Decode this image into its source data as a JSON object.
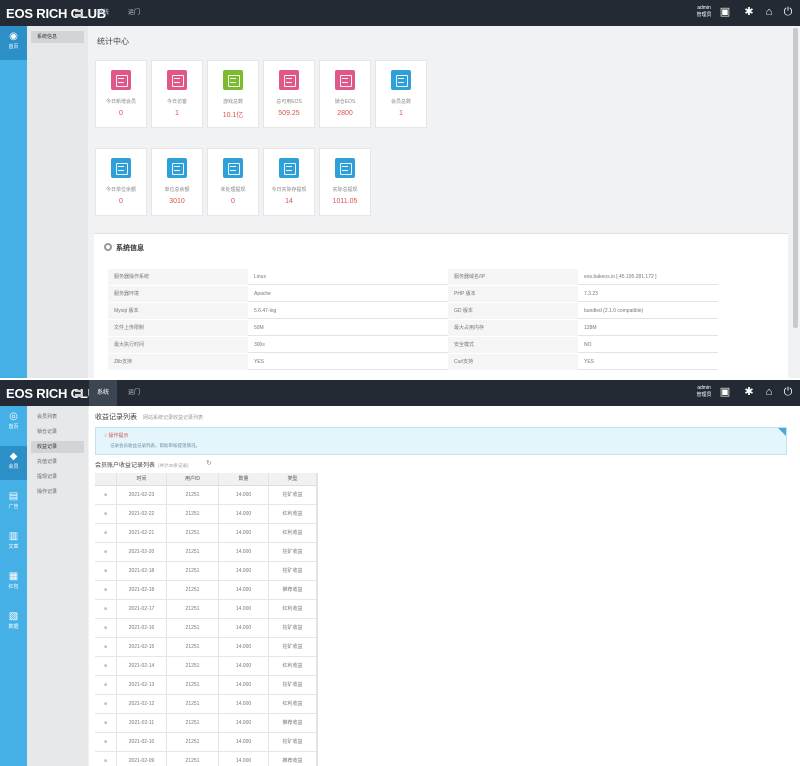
{
  "brand": "EOS RICH CLUB",
  "nav": [
    {
      "label": "系统",
      "active": true
    },
    {
      "label": "运门",
      "active": false
    }
  ],
  "user": {
    "name": "admin",
    "role": "管理员"
  },
  "shot1": {
    "rail": [
      {
        "label": "首页",
        "icon": "home-icon"
      }
    ],
    "submenu": [
      {
        "label": "系统信息",
        "active": true
      }
    ],
    "page_title": "统计中心",
    "cards_row1": [
      {
        "label": "今日新增会员",
        "value": "0",
        "color": "#e0578a"
      },
      {
        "label": "今日访客",
        "value": "1",
        "color": "#e0578a"
      },
      {
        "label": "游戏总数",
        "value": "10.1亿",
        "color": "#7cbb2f"
      },
      {
        "label": "总可用EOS",
        "value": "509.25",
        "color": "#e0578a"
      },
      {
        "label": "锁仓EOS",
        "value": "2800",
        "color": "#e0578a"
      },
      {
        "label": "会员总数",
        "value": "1",
        "color": "#2f9fd8"
      }
    ],
    "cards_row2": [
      {
        "label": "今日单位余额",
        "value": "0",
        "color": "#2f9fd8"
      },
      {
        "label": "单位总余额",
        "value": "3010",
        "color": "#2f9fd8"
      },
      {
        "label": "未处理提现",
        "value": "0",
        "color": "#2f9fd8"
      },
      {
        "label": "今日实际存提现",
        "value": "14",
        "color": "#2f9fd8"
      },
      {
        "label": "实际总提现",
        "value": "1011.05",
        "color": "#2f9fd8"
      }
    ],
    "sys_title": "系统信息",
    "sys_rows": [
      {
        "k1": "服务器操作系统",
        "v1": "Linux",
        "k2": "服务器域名/IP",
        "v2": "eos.bakeos.io [ 45.195.281.172 ]"
      },
      {
        "k1": "服务器环境",
        "v1": "Apache",
        "k2": "PHP 版本",
        "v2": "7.3.23"
      },
      {
        "k1": "Mysql 版本",
        "v1": "5.6.47-log",
        "k2": "GD 版本",
        "v2": "bundled (2.1.0 compatible)"
      },
      {
        "k1": "文件上传限制",
        "v1": "50M",
        "k2": "最大占用内存",
        "v2": "128M"
      },
      {
        "k1": "最大执行时间",
        "v1": "300s",
        "k2": "安全模式",
        "v2": "NO"
      },
      {
        "k1": "Zlib支持",
        "v1": "YES",
        "k2": "Curl支持",
        "v2": "YES"
      }
    ]
  },
  "shot2": {
    "rail": [
      {
        "label": "首页",
        "icon": "home-icon"
      },
      {
        "label": "会员",
        "icon": "diamond-icon"
      },
      {
        "label": "广告",
        "icon": "card-icon"
      },
      {
        "label": "文章",
        "icon": "document-icon"
      },
      {
        "label": "红包",
        "icon": "lock-icon"
      },
      {
        "label": "数据",
        "icon": "database-icon"
      }
    ],
    "submenu": [
      {
        "label": "会员列表",
        "active": false
      },
      {
        "label": "锁仓记录",
        "active": false
      },
      {
        "label": "收益记录",
        "active": true
      },
      {
        "label": "充值记录",
        "active": false
      },
      {
        "label": "提现记录",
        "active": false
      },
      {
        "label": "操作记录",
        "active": false
      }
    ],
    "crumb": "收益记录列表",
    "crumb_sub": "网站系统记录收益记录列表",
    "tip_title": "操作提示",
    "tip_text": "记录会员收益记录列表，帮助审核提现情况。",
    "list_title": "会员账户收益记录列表",
    "list_sub": "(共计30条记录)",
    "columns": [
      "",
      "时间",
      "用户ID",
      "数量",
      "类型"
    ],
    "rows": [
      [
        "2021-02-23",
        "21251",
        "14.000",
        "挖矿收益"
      ],
      [
        "2021-02-22",
        "21251",
        "14.000",
        "红利收益"
      ],
      [
        "2021-02-21",
        "21251",
        "14.000",
        "红利收益"
      ],
      [
        "2021-02-20",
        "21251",
        "14.000",
        "挖矿收益"
      ],
      [
        "2021-02-18",
        "21251",
        "14.000",
        "挖矿收益"
      ],
      [
        "2021-02-18",
        "21251",
        "14.000",
        "推荐收益"
      ],
      [
        "2021-02-17",
        "21251",
        "14.000",
        "红利收益"
      ],
      [
        "2021-02-16",
        "21251",
        "14.000",
        "挖矿收益"
      ],
      [
        "2021-02-15",
        "21251",
        "14.000",
        "挖矿收益"
      ],
      [
        "2021-02-14",
        "21251",
        "14.000",
        "红利收益"
      ],
      [
        "2021-02-13",
        "21251",
        "14.000",
        "挖矿收益"
      ],
      [
        "2021-02-12",
        "21251",
        "14.000",
        "红利收益"
      ],
      [
        "2021-02-11",
        "21251",
        "14.000",
        "推荐收益"
      ],
      [
        "2021-02-10",
        "21251",
        "14.000",
        "挖矿收益"
      ],
      [
        "2021-02-09",
        "21251",
        "14.000",
        "推荐收益"
      ]
    ]
  }
}
